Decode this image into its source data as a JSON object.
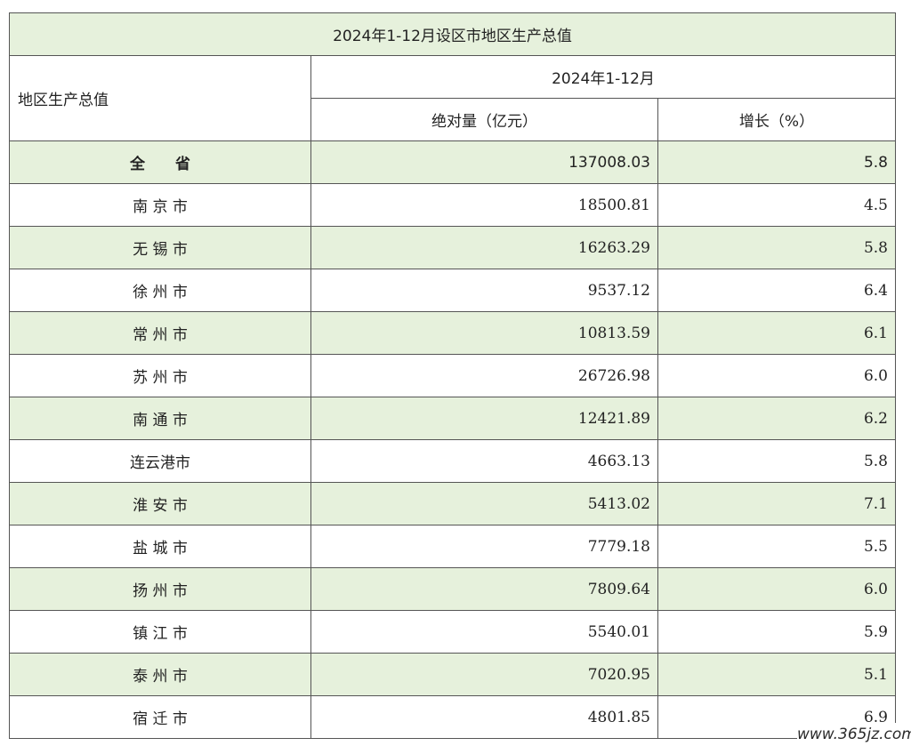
{
  "table": {
    "title": "2024年1-12月设区市地区生产总值",
    "row_header": "地区生产总值",
    "period_header": "2024年1-12月",
    "col_value": "绝对量（亿元）",
    "col_growth": "增长（%）",
    "rows": [
      {
        "region": "全　　省",
        "value": "137008.03",
        "growth": "5.8"
      },
      {
        "region": "南 京 市",
        "value": "18500.81",
        "growth": "4.5"
      },
      {
        "region": "无 锡 市",
        "value": "16263.29",
        "growth": "5.8"
      },
      {
        "region": "徐 州 市",
        "value": "9537.12",
        "growth": "6.4"
      },
      {
        "region": "常 州 市",
        "value": "10813.59",
        "growth": "6.1"
      },
      {
        "region": "苏 州 市",
        "value": "26726.98",
        "growth": "6.0"
      },
      {
        "region": "南 通 市",
        "value": "12421.89",
        "growth": "6.2"
      },
      {
        "region": "连云港市",
        "value": "4663.13",
        "growth": "5.8"
      },
      {
        "region": "淮 安 市",
        "value": "5413.02",
        "growth": "7.1"
      },
      {
        "region": "盐 城 市",
        "value": "7779.18",
        "growth": "5.5"
      },
      {
        "region": "扬 州 市",
        "value": "7809.64",
        "growth": "6.0"
      },
      {
        "region": "镇 江 市",
        "value": "5540.01",
        "growth": "5.9"
      },
      {
        "region": "泰 州 市",
        "value": "7020.95",
        "growth": "5.1"
      },
      {
        "region": "宿 迁 市",
        "value": "4801.85",
        "growth": "6.9"
      }
    ]
  },
  "watermark": "www.365jz.com"
}
